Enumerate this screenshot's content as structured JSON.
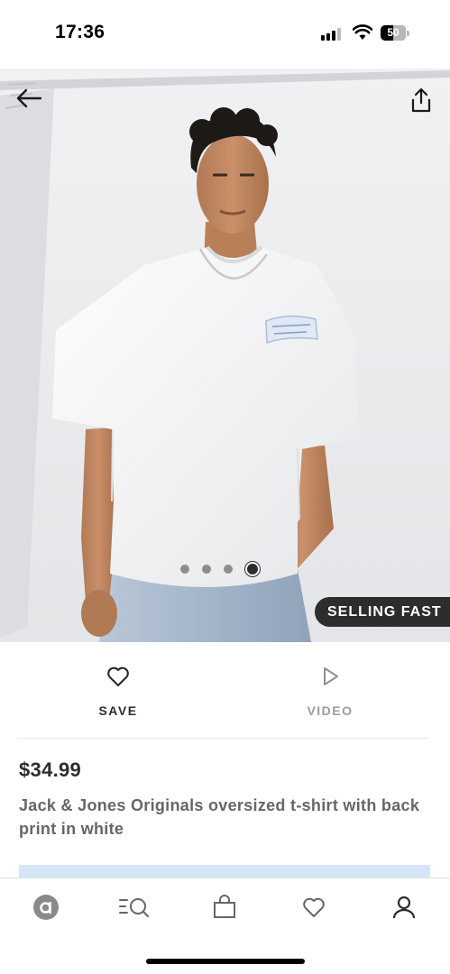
{
  "status_bar": {
    "time": "17:36",
    "battery_level": "50",
    "battery_fraction": 0.5,
    "signal_bars_filled": 3,
    "signal_bars_total": 4
  },
  "hero": {
    "image_description_icon": "product-photo-model-white-tshirt",
    "carousel": {
      "total": 4,
      "active_index": 3
    },
    "badge": "SELLING FAST"
  },
  "actions": {
    "save_label": "SAVE",
    "video_label": "VIDEO"
  },
  "product": {
    "price": "$34.99",
    "name": "Jack & Jones Originals oversized t-shirt with back print in white"
  },
  "nav": {
    "items": [
      {
        "icon": "home-logo-icon"
      },
      {
        "icon": "search-icon"
      },
      {
        "icon": "bag-icon"
      },
      {
        "icon": "heart-icon"
      },
      {
        "icon": "account-icon"
      }
    ]
  },
  "colors": {
    "text_dark": "#2d2d2d",
    "text_muted": "#666666",
    "badge_bg": "#2d2d2d",
    "accent_light_blue": "#d6e5f7"
  }
}
